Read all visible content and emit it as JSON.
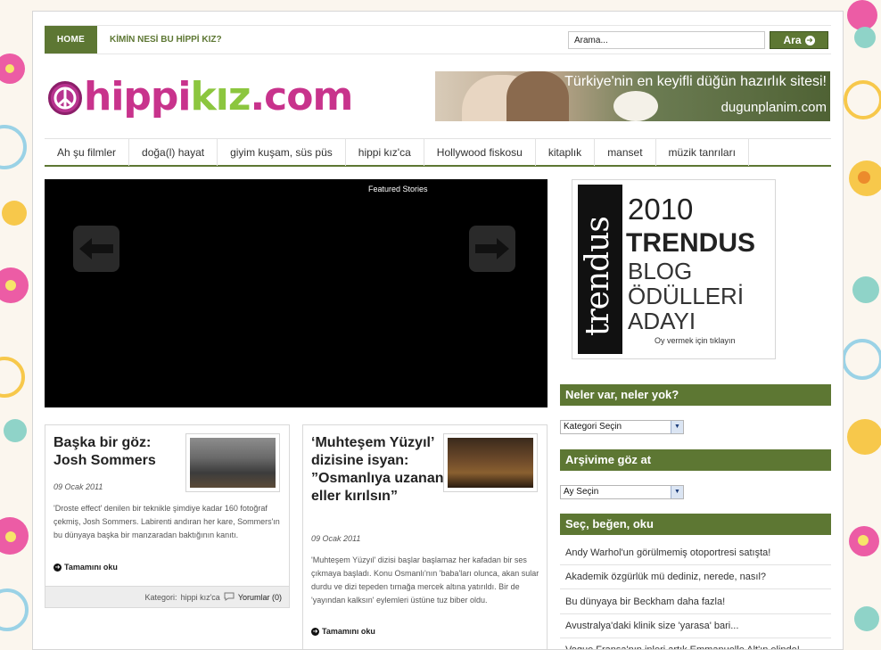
{
  "topbar": {
    "home_label": "HOME",
    "about_link": "KİMİN NESİ BU HİPPİ KIZ?",
    "search_placeholder": "Arama...",
    "search_button": "Ara"
  },
  "logo": {
    "part1": "hippi",
    "part2": "kız",
    "part3": ".com"
  },
  "banner": {
    "line1": "Türkiye'nin en keyifli düğün hazırlık sitesi!",
    "line2": "dugunplanim.com"
  },
  "categories": [
    "Ah şu filmler",
    "doğa(l) hayat",
    "giyim kuşam, süs püs",
    "hippi kız'ca",
    "Hollywood fiskosu",
    "kitaplık",
    "manset",
    "müzik tanrıları"
  ],
  "slider": {
    "label": "Featured Stories"
  },
  "posts": [
    {
      "title": "Başka bir göz: Josh Sommers",
      "date": "09 Ocak 2011",
      "excerpt": "'Droste effect' denilen bir teknikle şimdiye kadar 160 fotoğraf çekmiş, Josh Sommers. Labirenti andıran her kare, Sommers'ın bu dünyaya başka bir manzaradan baktığının kanıtı.",
      "more": "Tamamını oku",
      "category_label": "Kategori:",
      "category": "hippi kız'ca",
      "comments": "Yorumlar (0)"
    },
    {
      "title": "‘Muhteşem Yüzyıl’ dizisine isyan: ”Osmanlıya uzanan eller kırılsın”",
      "date": "09 Ocak 2011",
      "excerpt": "'Muhteşem Yüzyıl' dizisi başlar başlamaz her kafadan bir ses çıkmaya başladı. Konu Osmanlı'nın 'baba'ları olunca, akan sular durdu ve dizi tepeden tırnağa mercek altına yatırıldı. Bir de 'yayından kalksın' eylemleri üstüne tuz biber oldu.",
      "more": "Tamamını oku"
    }
  ],
  "award": {
    "band": "trendus",
    "year": "2010",
    "brand": "TRENDUS",
    "line3": "BLOG",
    "line4": "ÖDÜLLERİ",
    "line5": "ADAYI",
    "vote": "Oy vermek için tıklayın"
  },
  "sidebar": {
    "widget1_title": "Neler var, neler yok?",
    "category_select": "Kategori Seçin",
    "widget2_title": "Arşivime göz at",
    "month_select": "Ay Seçin",
    "widget3_title": "Seç, beğen, oku",
    "links": [
      "Andy Warhol'un görülmemiş otoportresi satışta!",
      "Akademik özgürlük mü dediniz, nerede, nasıl?",
      "Bu dünyaya bir Beckham daha fazla!",
      "Avustralya'daki klinik size 'yarasa' bari...",
      "Vogue Fransa'nın inleri artık Emmanuelle Alt'ın elinde!"
    ]
  },
  "colors": {
    "accent_green": "#5d7733",
    "logo_pink": "#c8338c",
    "logo_lime": "#8cc63f"
  }
}
